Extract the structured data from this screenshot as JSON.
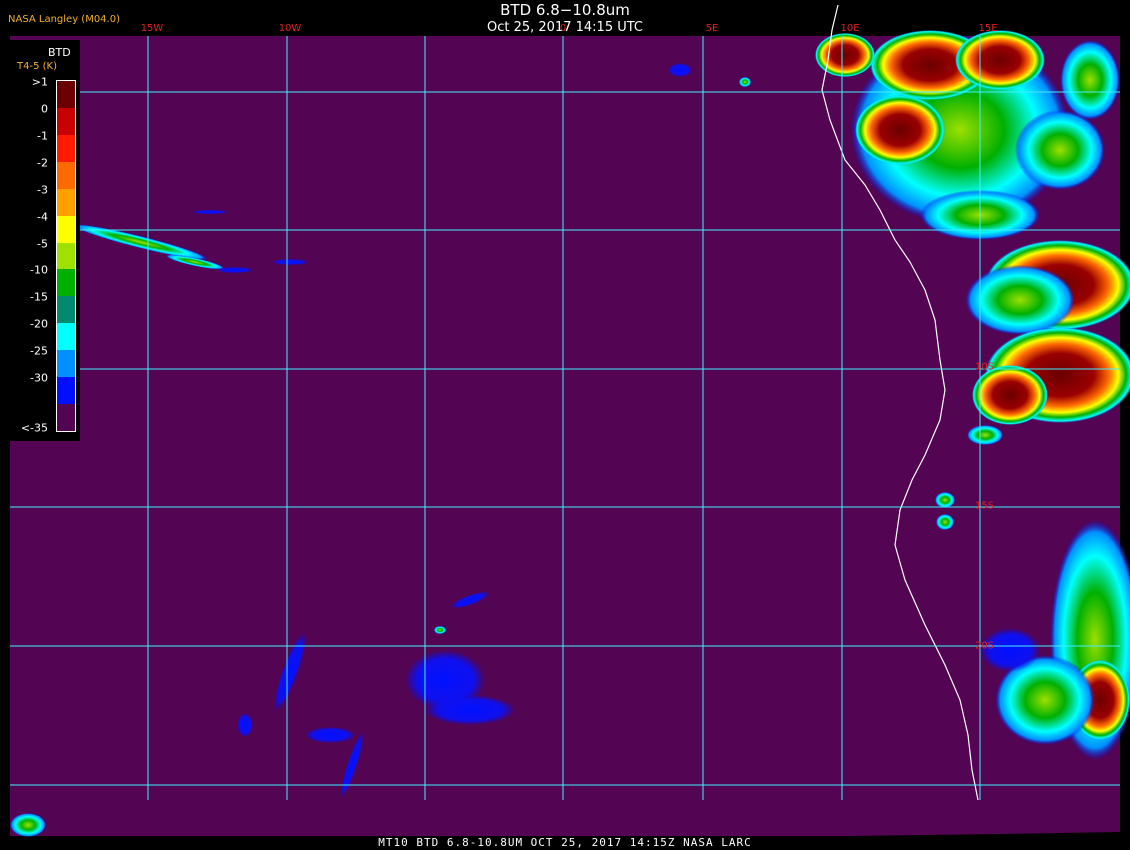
{
  "header": {
    "agency": "NASA Langley (M04.0)",
    "title": "BTD 6.8−10.8um",
    "subtitle": "Oct 25, 2017 14:15 UTC"
  },
  "footer": "MT10  BTD 6.8-10.8UM   OCT 25, 2017 14:15Z   NASA LARC",
  "longitude_labels": [
    "15W",
    "10W",
    "0",
    "5E",
    "10E",
    "15E"
  ],
  "latitude_labels": [
    "10S",
    "15S",
    "20S"
  ],
  "legend": {
    "title": "BTD",
    "units": "T4-5 (K)",
    "ticks": [
      ">1",
      "0",
      "-1",
      "-2",
      "-3",
      "-4",
      "-5",
      "-10",
      "-15",
      "-20",
      "-25",
      "-30",
      "<-35"
    ],
    "colors": [
      "#6b0000",
      "#c80000",
      "#ff1a00",
      "#ff6a00",
      "#ff9f00",
      "#ffff00",
      "#9ee000",
      "#00b000",
      "#008a70",
      "#00ffff",
      "#0090ff",
      "#0010ff",
      "#530452"
    ]
  },
  "colors": {
    "background": "#530452",
    "grid": "#3ff0ff",
    "coastline": "#ffffff",
    "label_red": "#e02020",
    "label_orange": "#f0b030"
  }
}
